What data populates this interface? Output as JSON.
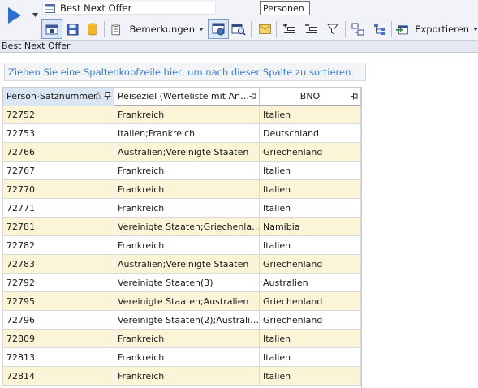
{
  "toolbar": {
    "combo_text": "Best Next Offer",
    "tooltip_text": "Personen",
    "bemerkungen_label": "Bemerkungen",
    "exportieren_label": "Exportieren"
  },
  "panel": {
    "title": "Best Next Offer"
  },
  "groupby": {
    "hint": "Ziehen Sie eine Spaltenkopfzeile hier, um nach dieser Spalte zu sortieren."
  },
  "grid": {
    "columns": [
      "Person-Satznummer",
      "Reiseziel (Werteliste mit An…",
      "BNO"
    ],
    "rows": [
      {
        "id": "72752",
        "reiseziel": "Frankreich",
        "bno": "Italien"
      },
      {
        "id": "72753",
        "reiseziel": "Italien;Frankreich",
        "bno": "Deutschland"
      },
      {
        "id": "72766",
        "reiseziel": "Australien;Vereinigte Staaten",
        "bno": "Griechenland"
      },
      {
        "id": "72767",
        "reiseziel": "Frankreich",
        "bno": "Italien"
      },
      {
        "id": "72770",
        "reiseziel": "Frankreich",
        "bno": "Italien"
      },
      {
        "id": "72771",
        "reiseziel": "Frankreich",
        "bno": "Italien"
      },
      {
        "id": "72781",
        "reiseziel": "Vereinigte Staaten;Griechenla…",
        "bno": "Namibia"
      },
      {
        "id": "72782",
        "reiseziel": "Frankreich",
        "bno": "Italien"
      },
      {
        "id": "72783",
        "reiseziel": "Australien;Vereinigte Staaten",
        "bno": "Griechenland"
      },
      {
        "id": "72792",
        "reiseziel": "Vereinigte Staaten(3)",
        "bno": "Australien"
      },
      {
        "id": "72795",
        "reiseziel": "Vereinigte Staaten;Australien",
        "bno": "Griechenland"
      },
      {
        "id": "72796",
        "reiseziel": "Vereinigte Staaten(2);Australi…",
        "bno": "Griechenland"
      },
      {
        "id": "72809",
        "reiseziel": "Frankreich",
        "bno": "Italien"
      },
      {
        "id": "72813",
        "reiseziel": "Frankreich",
        "bno": "Italien"
      },
      {
        "id": "72814",
        "reiseziel": "Frankreich",
        "bno": "Italien"
      }
    ]
  },
  "colors": {
    "accent_blue": "#2f6fd1",
    "alt_row": "#fbf4d6",
    "hint_text": "#3b7ccb"
  }
}
